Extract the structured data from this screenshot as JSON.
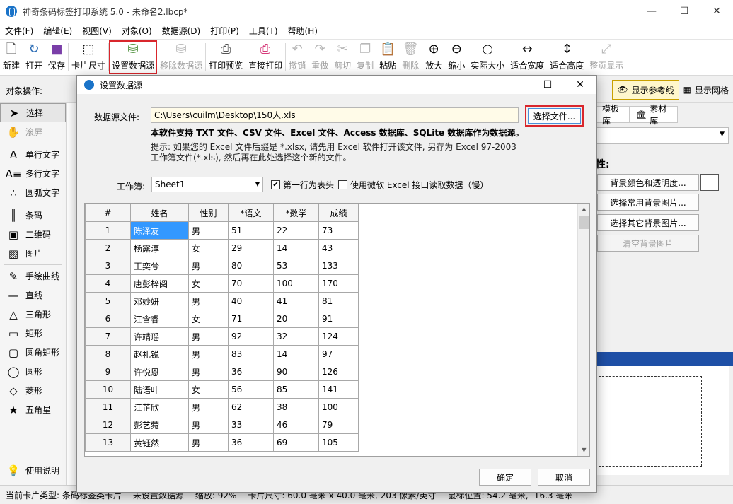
{
  "window": {
    "title": "神奇条码标签打印系统 5.0 - 未命名2.lbcp*",
    "minimize": "—",
    "maximize": "☐",
    "close": "✕"
  },
  "menu": [
    "文件(F)",
    "编辑(E)",
    "视图(V)",
    "对象(O)",
    "数据源(D)",
    "打印(P)",
    "工具(T)",
    "帮助(H)"
  ],
  "toolbar": {
    "new": "新建",
    "open": "打开",
    "save": "保存",
    "card_size": "卡片尺寸",
    "set_datasource": "设置数据源",
    "remove_datasource": "移除数据源",
    "print_preview": "打印预览",
    "direct_print": "直接打印",
    "undo": "撤销",
    "redo": "重做",
    "cut": "剪切",
    "copy": "复制",
    "paste": "粘贴",
    "delete": "删除",
    "zoom_in": "放大",
    "zoom_out": "缩小",
    "actual_size": "实际大小",
    "fit_width": "适合宽度",
    "fit_height": "适合高度",
    "whole_page": "整页显示"
  },
  "opbar": {
    "label": "对象操作:",
    "show_ref_lines": "显示参考线",
    "show_grid": "显示网格"
  },
  "palette": {
    "select": "选择",
    "scroll": "滚屏",
    "single_text": "单行文字",
    "multi_text": "多行文字",
    "arc_text": "圆弧文字",
    "barcode": "条码",
    "qrcode": "二维码",
    "image": "图片",
    "freehand": "手绘曲线",
    "line": "直线",
    "triangle": "三角形",
    "rect": "矩形",
    "round_rect": "圆角矩形",
    "circle": "圆形",
    "diamond": "菱形",
    "star": "五角星",
    "help": "使用说明"
  },
  "rpanel": {
    "tab_template": "模板库",
    "tab_material": "素材库",
    "label": "性:",
    "bg_color": "背景颜色和透明度...",
    "common_bg": "选择常用背景图片...",
    "other_bg": "选择其它背景图片...",
    "clear_bg": "清空背景图片"
  },
  "status": {
    "card_type": "当前卡片类型: 条码标签类卡片",
    "datasource": "未设置数据源",
    "zoom": "缩放: 92%",
    "card_size": "卡片尺寸: 60.0 毫米 x 40.0 毫米, 203 像素/英寸",
    "mouse": "鼠标位置: 54.2 毫米, -16.3 毫米"
  },
  "dialog": {
    "title": "设置数据源",
    "maximize": "☐",
    "close": "✕",
    "ds_label": "数据源文件:",
    "ds_path": "C:\\Users\\cuilm\\Desktop\\150人.xls",
    "choose_file": "选择文件...",
    "support": "本软件支持 TXT 文件、CSV 文件、Excel 文件、Access 数据库、SQLite 数据库作为数据源。",
    "hint1": "提示: 如果您的 Excel 文件后缀是 *.xlsx, 请先用 Excel 软件打开该文件, 另存为 Excel 97-2003",
    "hint2": "工作簿文件(*.xls), 然后再在此处选择这个新的文件。",
    "workbook_label": "工作簿:",
    "workbook_value": "Sheet1",
    "first_row_header": "第一行为表头",
    "use_ms_excel": "使用微软 Excel 接口读取数据（慢）",
    "first_row_checked": "✔",
    "ok": "确定",
    "cancel": "取消"
  },
  "table": {
    "headers": [
      "#",
      "姓名",
      "性别",
      "*语文",
      "*数学",
      "成绩"
    ],
    "rows": [
      [
        "1",
        "陈泽友",
        "男",
        "51",
        "22",
        "73"
      ],
      [
        "2",
        "杨露淳",
        "女",
        "29",
        "14",
        "43"
      ],
      [
        "3",
        "王奕兮",
        "男",
        "80",
        "53",
        "133"
      ],
      [
        "4",
        "唐彭梓阅",
        "女",
        "70",
        "100",
        "170"
      ],
      [
        "5",
        "邓妙妍",
        "男",
        "40",
        "41",
        "81"
      ],
      [
        "6",
        "江含睿",
        "女",
        "71",
        "20",
        "91"
      ],
      [
        "7",
        "许靖瑶",
        "男",
        "92",
        "32",
        "124"
      ],
      [
        "8",
        "赵礼锐",
        "男",
        "83",
        "14",
        "97"
      ],
      [
        "9",
        "许悦恩",
        "男",
        "36",
        "90",
        "126"
      ],
      [
        "10",
        "陆语叶",
        "女",
        "56",
        "85",
        "141"
      ],
      [
        "11",
        "江芷欣",
        "男",
        "62",
        "38",
        "100"
      ],
      [
        "12",
        "彭艺菀",
        "男",
        "33",
        "46",
        "79"
      ],
      [
        "13",
        "黄钰然",
        "男",
        "36",
        "69",
        "105"
      ]
    ]
  },
  "colors": {
    "highlight_red": "#d9262c",
    "selection_blue": "#3398ff",
    "path_bg": "#fffbe8"
  }
}
